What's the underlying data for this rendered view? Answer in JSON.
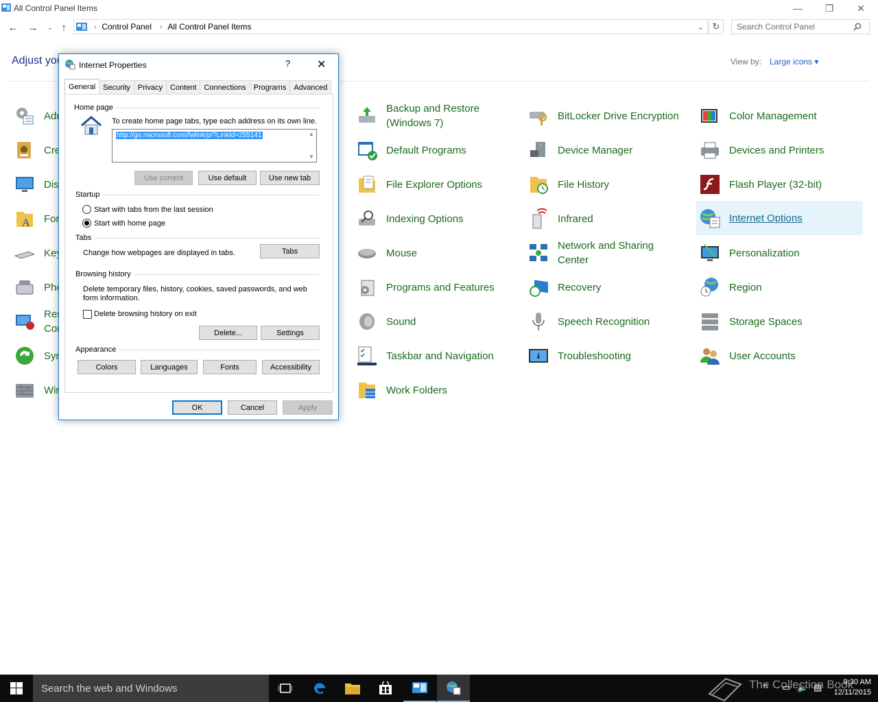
{
  "window": {
    "title": "All Control Panel Items",
    "minimize": "—",
    "restore": "❐",
    "close": "✕"
  },
  "address": {
    "crumbs": [
      "Control Panel",
      "All Control Panel Items"
    ],
    "search_placeholder": "Search Control Panel"
  },
  "header": {
    "heading": "Adjust you",
    "view_by_label": "View by:",
    "view_by_value": "Large icons ▾"
  },
  "left_column_visible": [
    "Adr",
    "Cre",
    "Dis",
    "For",
    "Key",
    "Pho",
    "Rer",
    "Cor",
    "Syr",
    "Wir"
  ],
  "items": {
    "col3": [
      "Backup and Restore",
      "(Windows 7)",
      "Default Programs",
      "File Explorer Options",
      "Indexing Options",
      "Mouse",
      "Programs and Features",
      "Sound",
      "Taskbar and Navigation",
      "Work Folders"
    ],
    "col4": [
      "BitLocker Drive Encryption",
      "Device Manager",
      "File History",
      "Infrared",
      "Network and Sharing",
      "Center",
      "Recovery",
      "Speech Recognition",
      "Troubleshooting"
    ],
    "col5": [
      "Color Management",
      "Devices and Printers",
      "Flash Player (32-bit)",
      "Internet Options",
      "Personalization",
      "Region",
      "Storage Spaces",
      "User Accounts"
    ]
  },
  "dialog": {
    "title": "Internet Properties",
    "help": "?",
    "close": "✕",
    "tabs": [
      "General",
      "Security",
      "Privacy",
      "Content",
      "Connections",
      "Programs",
      "Advanced"
    ],
    "home_page_label": "Home page",
    "home_page_text": "To create home page tabs, type each address on its own line.",
    "home_page_url": "http://go.microsoft.com/fwlink/p/?LinkId=255141",
    "btn_use_current": "Use current",
    "btn_use_default": "Use default",
    "btn_use_new_tab": "Use new tab",
    "startup_label": "Startup",
    "startup_opt1": "Start with tabs from the last session",
    "startup_opt2": "Start with home page",
    "tabs_label": "Tabs",
    "tabs_text": "Change how webpages are displayed in tabs.",
    "btn_tabs": "Tabs",
    "history_label": "Browsing history",
    "history_text_1": "Delete temporary files, history, cookies, saved passwords, and web",
    "history_text_2": "form information.",
    "history_checkbox": "Delete browsing history on exit",
    "btn_delete": "Delete...",
    "btn_settings": "Settings",
    "appearance_label": "Appearance",
    "btn_colors": "Colors",
    "btn_languages": "Languages",
    "btn_fonts": "Fonts",
    "btn_accessibility": "Accessibility",
    "btn_ok": "OK",
    "btn_cancel": "Cancel",
    "btn_apply": "Apply"
  },
  "taskbar": {
    "search_text": "Search the web and Windows",
    "watermark": "The Collection Book",
    "time": "9:30 AM",
    "date": "12/11/2015"
  }
}
